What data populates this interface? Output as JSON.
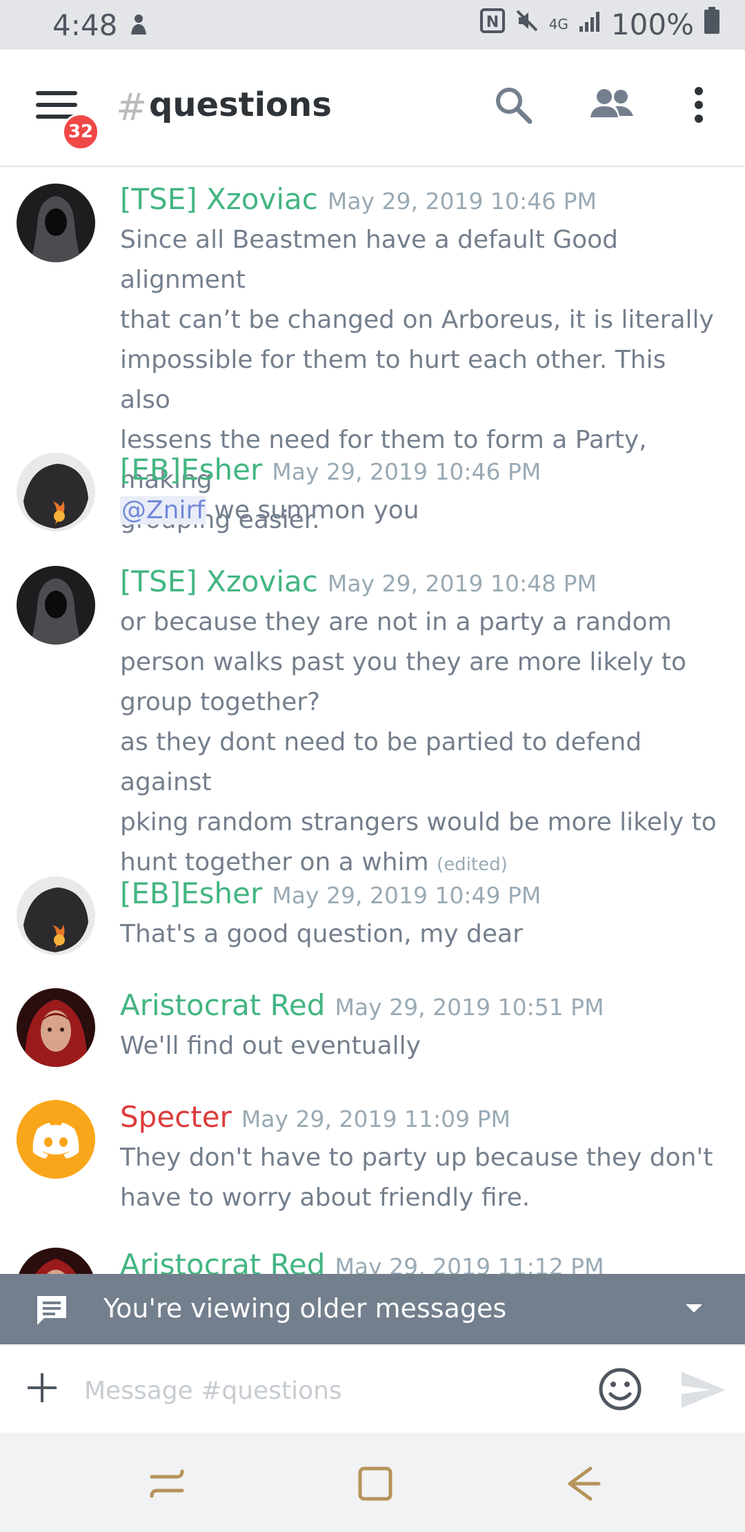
{
  "status_bar": {
    "time": "4:48",
    "battery": "100%",
    "network": "4G",
    "icons": [
      "nfc-icon",
      "mute-icon",
      "signal-icon",
      "battery-icon"
    ]
  },
  "header": {
    "unread_badge": "32",
    "hash": "#",
    "channel_name": "questions",
    "icons": [
      "menu-icon",
      "search-icon",
      "members-icon",
      "more-icon"
    ]
  },
  "messages": [
    {
      "author": "[TSE] Xzoviac",
      "author_color": "#43b581",
      "timestamp": "May 29, 2019 10:46 PM",
      "lines": [
        "Since all Beastmen have a default Good alignment",
        "that can’t be changed on Arboreus, it is literally",
        "impossible for them to hurt each other. This also",
        "lessens the need for them to form a Party, making",
        "grouping easier."
      ]
    },
    {
      "author": "[EB]Esher",
      "author_color": "#43b581",
      "timestamp": "May 29, 2019 10:46 PM",
      "mention": "@Znirf",
      "text_after_mention": " we summon you"
    },
    {
      "author": "[TSE] Xzoviac",
      "author_color": "#43b581",
      "timestamp": "May 29, 2019 10:48 PM",
      "lines": [
        "or because they are not in a party a random",
        "person walks past you they are more likely to",
        "group together?",
        "as they dont need to be partied to defend against",
        "pking random strangers would be more likely to",
        "hunt together on a whim"
      ],
      "edited": "(edited)"
    },
    {
      "author": "[EB]Esher",
      "author_color": "#43b581",
      "timestamp": "May 29, 2019 10:49 PM",
      "lines": [
        "That's a good question, my dear"
      ]
    },
    {
      "author": "Aristocrat Red",
      "author_color": "#43b581",
      "timestamp": "May 29, 2019 10:51 PM",
      "lines": [
        "We'll find out eventually"
      ]
    },
    {
      "author": "Specter",
      "author_color": "#dd3c3c",
      "timestamp": "May 29, 2019 11:09 PM",
      "lines": [
        "They don't have to party up because they don't",
        "have to worry about friendly fire."
      ]
    },
    {
      "author": "Aristocrat Red",
      "author_color": "#43b581",
      "timestamp": "May 29, 2019 11:12 PM",
      "lines": []
    }
  ],
  "older_banner": {
    "text": "You're viewing older messages"
  },
  "composer": {
    "placeholder": "Message #questions"
  },
  "nav_bar": {
    "icons": [
      "recents-icon",
      "home-icon",
      "back-icon"
    ]
  },
  "colors": {
    "accent": "#7289da",
    "banner": "#747f8d",
    "discord_orange": "#faa61a",
    "badge_red": "#f04747"
  }
}
